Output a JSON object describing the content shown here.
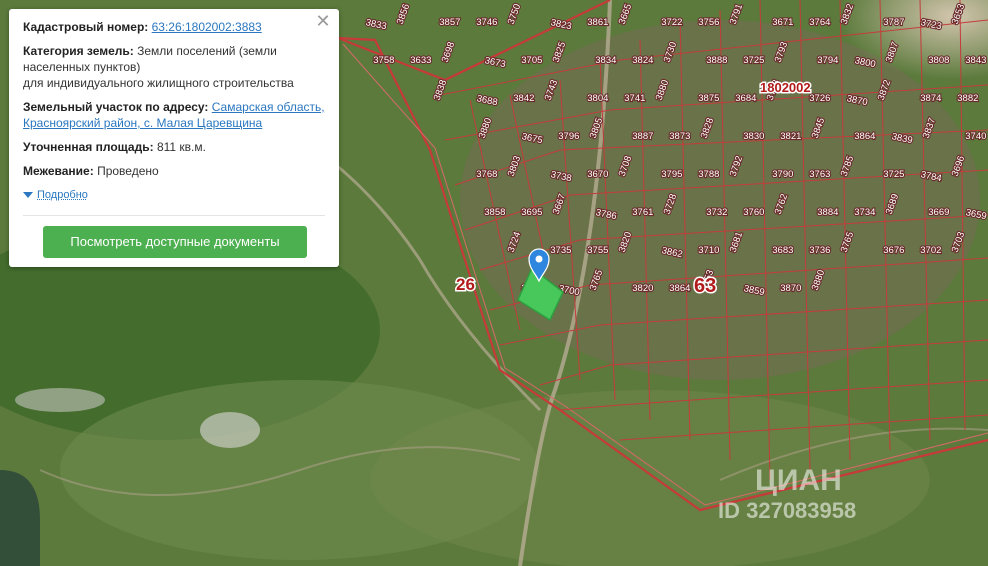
{
  "panel": {
    "cadastral_label": "Кадастровый номер:",
    "cadastral_number": "63:26:1802002:3883",
    "category_label": "Категория земель:",
    "category_value": "Земли поселений (земли населенных пунктов)",
    "category_value_2": "для индивидуального жилищного строительства",
    "address_label": "Земельный участок по адресу:",
    "address_value": "Самарская область, Красноярский район, с. Малая Царевщина",
    "area_label": "Уточненная площадь:",
    "area_value": "811 кв.м.",
    "survey_label": "Межевание:",
    "survey_value": "Проведено",
    "more_link": "Подробно",
    "docs_button": "Посмотреть доступные документы",
    "close_icon": "close-icon"
  },
  "map": {
    "district_label": "26",
    "block_label": "63",
    "quarter_label": "1802002",
    "watermark_logo": "ЦИАН",
    "watermark_id": "ID 327083958",
    "marker_icon": "location-pin-icon",
    "parcels": [
      "3833",
      "3856",
      "3857",
      "3746",
      "3750",
      "3823",
      "3861",
      "3665",
      "3722",
      "3756",
      "3791",
      "3671",
      "3764",
      "3832",
      "3787",
      "3723",
      "3653",
      "3758",
      "3633",
      "3698",
      "3673",
      "3705",
      "3825",
      "3834",
      "3824",
      "3730",
      "3888",
      "3725",
      "3793",
      "3794",
      "3800",
      "3807",
      "3808",
      "3843",
      "3838",
      "3688",
      "3842",
      "3743",
      "3804",
      "3741",
      "3880",
      "3875",
      "3684",
      "3798",
      "3726",
      "3870",
      "3872",
      "3874",
      "3882",
      "3880",
      "3675",
      "3796",
      "3805",
      "3887",
      "3873",
      "3828",
      "3830",
      "3821",
      "3845",
      "3864",
      "3839",
      "3837",
      "3740",
      "3768",
      "3803",
      "3738",
      "3670",
      "3708",
      "3795",
      "3788",
      "3792",
      "3790",
      "3763",
      "3785",
      "3725",
      "3784",
      "3696",
      "3858",
      "3695",
      "3667",
      "3786",
      "3761",
      "3728",
      "3732",
      "3760",
      "3762",
      "3884",
      "3734",
      "3689",
      "3669",
      "3659",
      "3724",
      "3735",
      "3755",
      "3820",
      "3862",
      "3710",
      "3681",
      "3683",
      "3736",
      "3765",
      "3676",
      "3702",
      "3703",
      "3797",
      "3700",
      "3765",
      "3820",
      "3864",
      "3753",
      "3859",
      "3870",
      "3880"
    ]
  }
}
